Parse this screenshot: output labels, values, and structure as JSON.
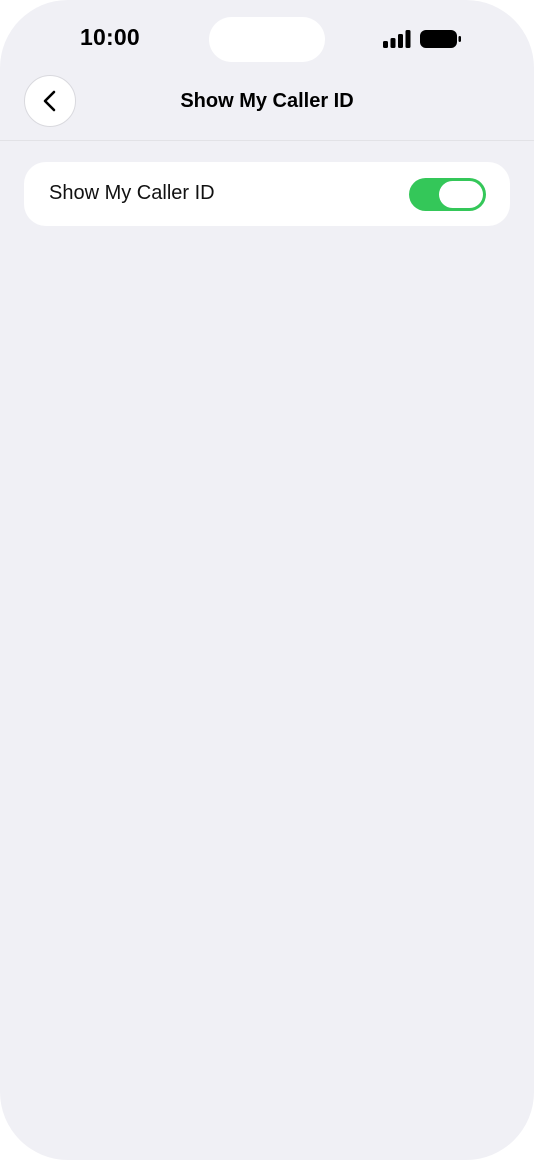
{
  "status_bar": {
    "time": "10:00",
    "signal_icon": "cellular-signal-icon",
    "battery_icon": "battery-icon"
  },
  "nav": {
    "back_icon": "chevron-left-icon",
    "title": "Show My Caller ID"
  },
  "settings": {
    "rows": [
      {
        "label": "Show My Caller ID",
        "toggle_on": true
      }
    ]
  },
  "colors": {
    "background": "#f0f0f5",
    "card": "#ffffff",
    "toggle_on": "#34c759"
  }
}
